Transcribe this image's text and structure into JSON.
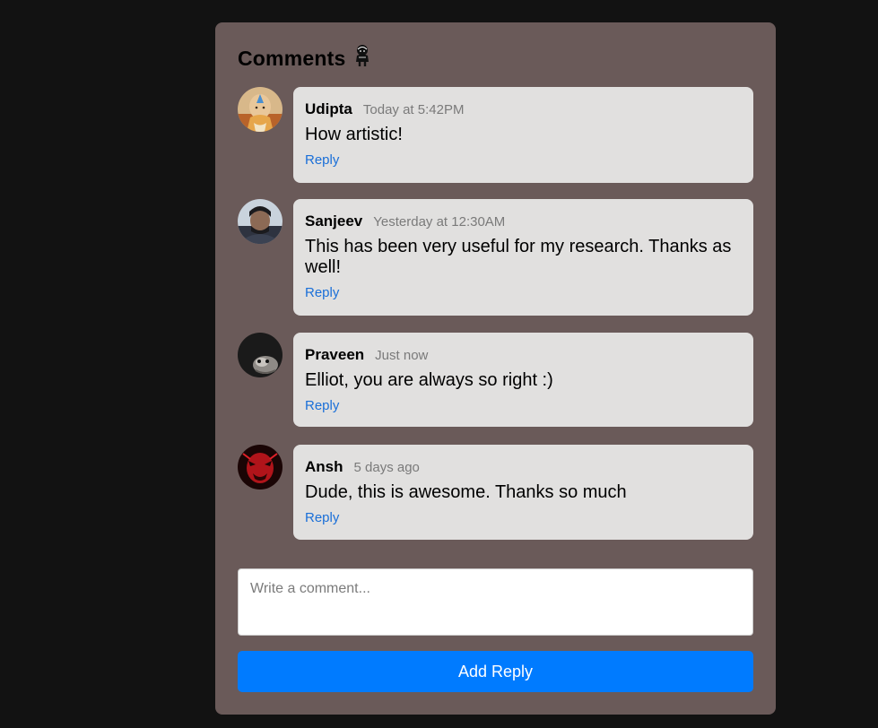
{
  "header": {
    "title": "Comments",
    "icon": "person-avatar-icon"
  },
  "comments": [
    {
      "author": "Udipta",
      "time": "Today at 5:42PM",
      "text": "How artistic!",
      "reply_label": "Reply",
      "avatar": "avatar-udipta"
    },
    {
      "author": "Sanjeev",
      "time": "Yesterday at 12:30AM",
      "text": "This has been very useful for my research. Thanks as well!",
      "reply_label": "Reply",
      "avatar": "avatar-sanjeev"
    },
    {
      "author": "Praveen",
      "time": "Just now",
      "text": "Elliot, you are always so right :)",
      "reply_label": "Reply",
      "avatar": "avatar-praveen"
    },
    {
      "author": "Ansh",
      "time": "5 days ago",
      "text": "Dude, this is awesome. Thanks so much",
      "reply_label": "Reply",
      "avatar": "avatar-ansh"
    }
  ],
  "composer": {
    "placeholder": "Write a comment...",
    "value": "",
    "button_label": "Add Reply"
  },
  "colors": {
    "page_background": "#121212",
    "panel_background": "#6a5a59",
    "bubble_background": "#e1e0df",
    "reply_link": "#1a6fd8",
    "button_background": "#007bff"
  }
}
